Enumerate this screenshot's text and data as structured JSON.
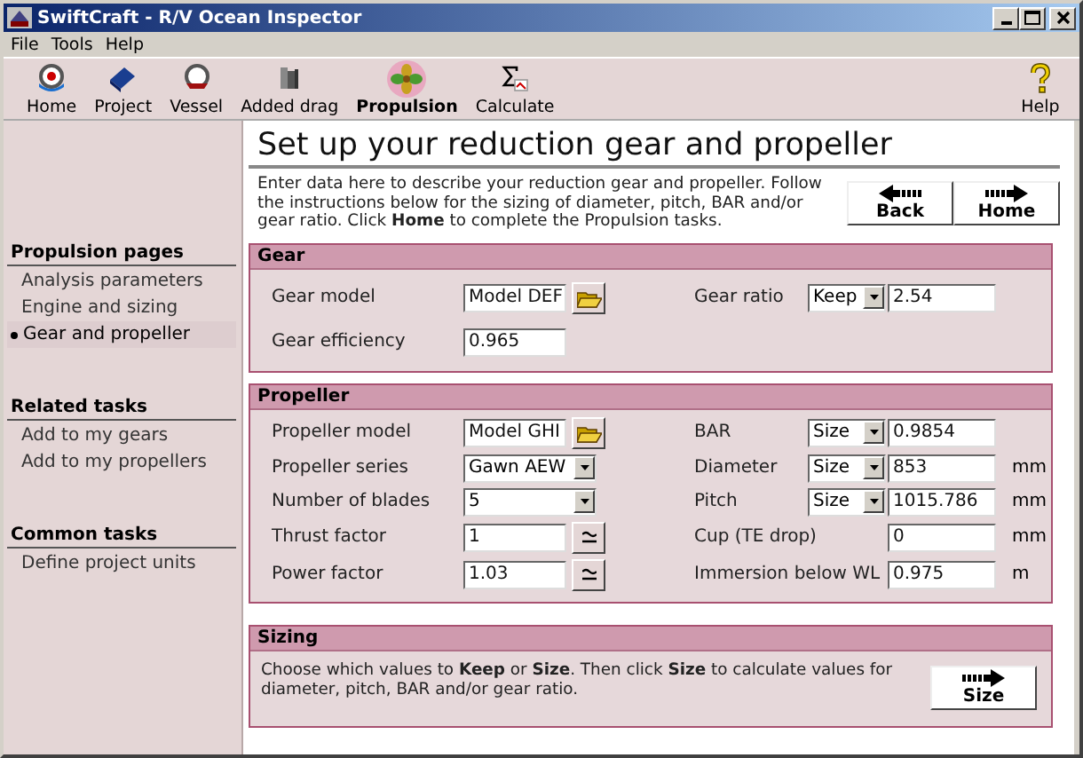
{
  "window": {
    "title": "SwiftCraft - R/V Ocean Inspector"
  },
  "menu": [
    {
      "label": "File"
    },
    {
      "label": "Tools"
    },
    {
      "label": "Help"
    }
  ],
  "toolbar": [
    {
      "label": "Home",
      "selected": false
    },
    {
      "label": "Project",
      "selected": false
    },
    {
      "label": "Vessel",
      "selected": false
    },
    {
      "label": "Added drag",
      "selected": false
    },
    {
      "label": "Propulsion",
      "selected": true
    },
    {
      "label": "Calculate",
      "selected": false
    }
  ],
  "help_button": {
    "label": "Help"
  },
  "sidebar": [
    {
      "heading": "Propulsion pages",
      "items": [
        {
          "label": "Analysis parameters",
          "selected": false
        },
        {
          "label": "Engine and sizing",
          "selected": false
        },
        {
          "label": "Gear and propeller",
          "selected": true
        }
      ]
    },
    {
      "heading": "Related tasks",
      "items": [
        {
          "label": "Add to my gears",
          "selected": false
        },
        {
          "label": "Add to my propellers",
          "selected": false
        }
      ]
    },
    {
      "heading": "Common tasks",
      "items": [
        {
          "label": "Define project units",
          "selected": false
        }
      ]
    }
  ],
  "page_title": "Set up your reduction gear and propeller",
  "intro": "Enter data here to describe your reduction gear and propeller. Follow the instructions below for the sizing of diameter, pitch, BAR and/or gear ratio. Click **Home** to complete the Propulsion tasks.",
  "nav_buttons": [
    {
      "label": "Back",
      "kind": "back"
    },
    {
      "label": "Home",
      "kind": "forward"
    }
  ],
  "panels": [
    {
      "title": "Gear",
      "rows": [
        {
          "left": {
            "kind": "file",
            "label": "Gear model",
            "value": "Model DEF"
          },
          "right": {
            "kind": "mode",
            "label": "Gear ratio",
            "mode": "Keep",
            "value": "2.54"
          }
        },
        {
          "left": {
            "kind": "text",
            "label": "Gear efficiency",
            "value": "0.965"
          }
        }
      ]
    },
    {
      "title": "Propeller",
      "rows": [
        {
          "left": {
            "kind": "file",
            "label": "Propeller model",
            "value": "Model GHI"
          },
          "right": {
            "kind": "mode",
            "label": "BAR",
            "mode": "Size",
            "value": "0.9854"
          }
        },
        {
          "left": {
            "kind": "select",
            "label": "Propeller series",
            "value": "Gawn AEW"
          },
          "right": {
            "kind": "mode",
            "label": "Diameter",
            "mode": "Size",
            "value": "853",
            "unit": "mm"
          }
        },
        {
          "left": {
            "kind": "select",
            "label": "Number of blades",
            "value": "5"
          },
          "right": {
            "kind": "mode",
            "label": "Pitch",
            "mode": "Size",
            "value": "1015.786",
            "unit": "mm"
          }
        },
        {
          "left": {
            "kind": "spin",
            "label": "Thrust factor",
            "value": "1"
          },
          "right": {
            "kind": "text",
            "label": "Cup (TE drop)",
            "value": "0",
            "unit": "mm"
          }
        },
        {
          "left": {
            "kind": "spin",
            "label": "Power factor",
            "value": "1.03"
          },
          "right": {
            "kind": "text",
            "label": "Immersion below WL",
            "value": "0.975",
            "unit": "m"
          }
        }
      ]
    }
  ],
  "sizing": {
    "title": "Sizing",
    "text": "Choose which values to **Keep** or **Size**. Then click **Size** to calculate values for diameter, pitch, BAR and/or gear ratio.",
    "button": {
      "label": "Size",
      "kind": "forward"
    }
  }
}
